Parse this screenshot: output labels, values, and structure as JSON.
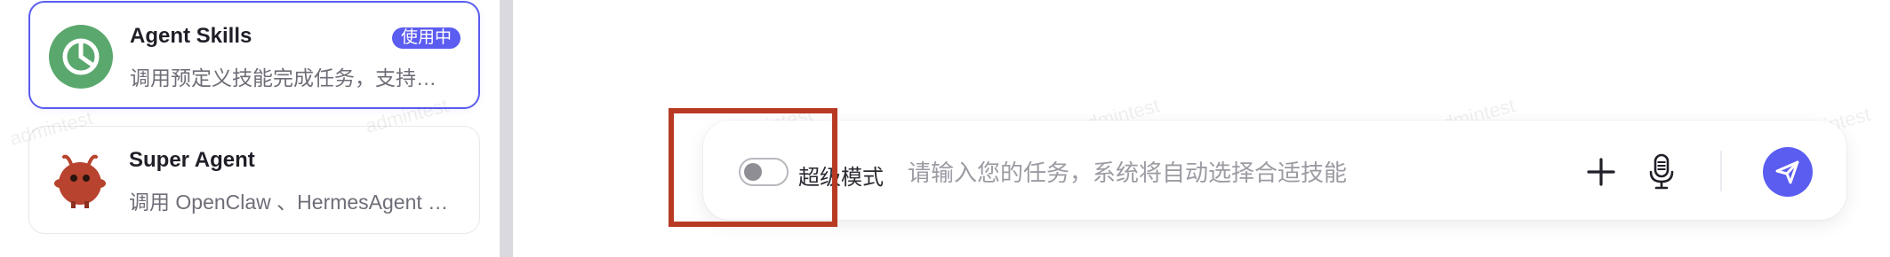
{
  "sidebar": {
    "cards": [
      {
        "title": "Agent Skills",
        "description": "调用预定义技能完成任务，支持…",
        "badge": "使用中",
        "icon": "pie-chart-icon",
        "icon_bg": "#5aa86e"
      },
      {
        "title": "Super Agent",
        "description": "调用 OpenClaw 、HermesAgent …",
        "icon": "red-bug-mascot-icon"
      }
    ]
  },
  "watermark": "admintest",
  "input_bar": {
    "toggle_on": false,
    "mode_label": "超级模式",
    "placeholder": "请输入您的任务，系统将自动选择合适技能",
    "add_icon": "plus-icon",
    "mic_icon": "microphone-icon",
    "send_icon": "send-icon"
  },
  "colors": {
    "accent": "#5b5cf0",
    "highlight": "#b83a22"
  }
}
